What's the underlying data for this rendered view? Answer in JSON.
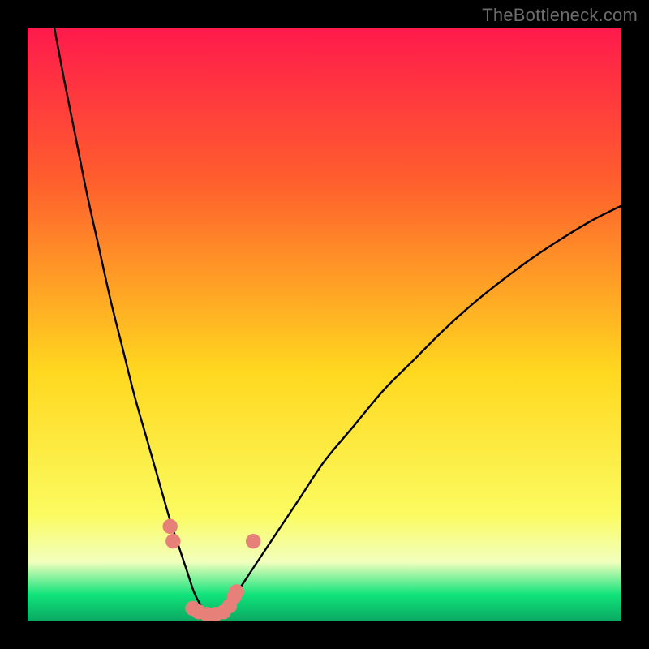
{
  "watermark": {
    "text": "TheBottleneck.com"
  },
  "colors": {
    "black": "#000000",
    "curve": "#000000",
    "dot": "#e8807a",
    "grad_top": "#ff1a4c",
    "grad_upper": "#ff5f2d",
    "grad_mid": "#ffd81f",
    "grad_lower": "#fbfb60",
    "grad_pale": "#f2ffbe",
    "grad_green": "#10e37a",
    "grad_dgreen": "#0aa862"
  },
  "chart_data": {
    "type": "line",
    "title": "",
    "xlabel": "",
    "ylabel": "",
    "xlim": [
      0,
      100
    ],
    "ylim": [
      0,
      100
    ],
    "series": [
      {
        "name": "bottleneck-curve",
        "x": [
          4.5,
          6,
          8,
          10,
          12,
          14,
          16,
          18,
          20,
          22,
          24,
          25,
          26,
          27,
          28,
          29,
          30,
          31,
          32,
          33,
          35,
          38,
          42,
          46,
          50,
          55,
          60,
          65,
          70,
          75,
          80,
          85,
          90,
          95,
          100
        ],
        "y": [
          100,
          92,
          82,
          72,
          63,
          54,
          46,
          38,
          31,
          24,
          17,
          14,
          11,
          8,
          5,
          3,
          1.5,
          1,
          1.2,
          2,
          4.5,
          9,
          15,
          21,
          27,
          33,
          39,
          44,
          49,
          53.5,
          57.5,
          61.2,
          64.5,
          67.5,
          70
        ]
      }
    ],
    "markers": [
      {
        "x": 24.0,
        "y": 16
      },
      {
        "x": 24.5,
        "y": 13.5
      },
      {
        "x": 27.8,
        "y": 2.2
      },
      {
        "x": 28.8,
        "y": 1.6
      },
      {
        "x": 30.2,
        "y": 1.2
      },
      {
        "x": 31.6,
        "y": 1.2
      },
      {
        "x": 33.0,
        "y": 1.6
      },
      {
        "x": 34.0,
        "y": 2.6
      },
      {
        "x": 34.8,
        "y": 4.2
      },
      {
        "x": 35.2,
        "y": 5.0
      },
      {
        "x": 38.0,
        "y": 13.5
      }
    ],
    "gradient_stops": [
      {
        "offset": 0.0,
        "key": "grad_top"
      },
      {
        "offset": 0.26,
        "key": "grad_upper"
      },
      {
        "offset": 0.58,
        "key": "grad_mid"
      },
      {
        "offset": 0.82,
        "key": "grad_lower"
      },
      {
        "offset": 0.9,
        "key": "grad_pale"
      },
      {
        "offset": 0.955,
        "key": "grad_green"
      },
      {
        "offset": 1.0,
        "key": "grad_dgreen"
      }
    ]
  }
}
